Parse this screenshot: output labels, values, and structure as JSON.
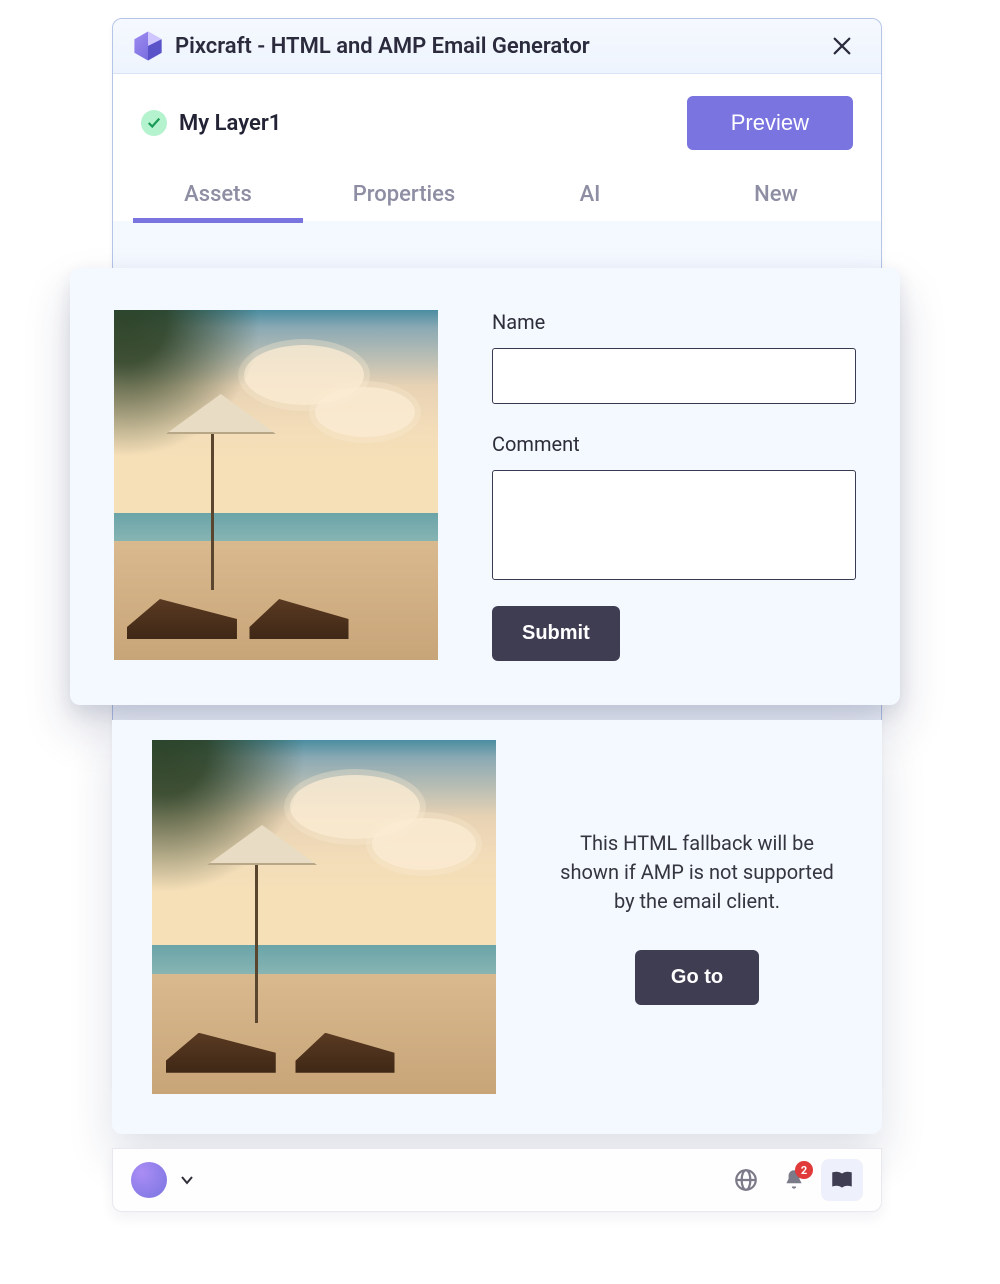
{
  "app": {
    "title": "Pixcraft  - HTML and AMP Email Generator"
  },
  "header": {
    "layer_name": "My Layer1",
    "preview_label": "Preview"
  },
  "tabs": [
    {
      "label": "Assets",
      "active": true
    },
    {
      "label": "Properties",
      "active": false
    },
    {
      "label": "AI",
      "active": false
    },
    {
      "label": "New",
      "active": false
    }
  ],
  "amp_form": {
    "name_label": "Name",
    "comment_label": "Comment",
    "submit_label": "Submit"
  },
  "fallback": {
    "message": "This HTML fallback will be shown if AMP is not supported by the email client.",
    "goto_label": "Go to"
  },
  "bottombar": {
    "notification_count": "2"
  }
}
